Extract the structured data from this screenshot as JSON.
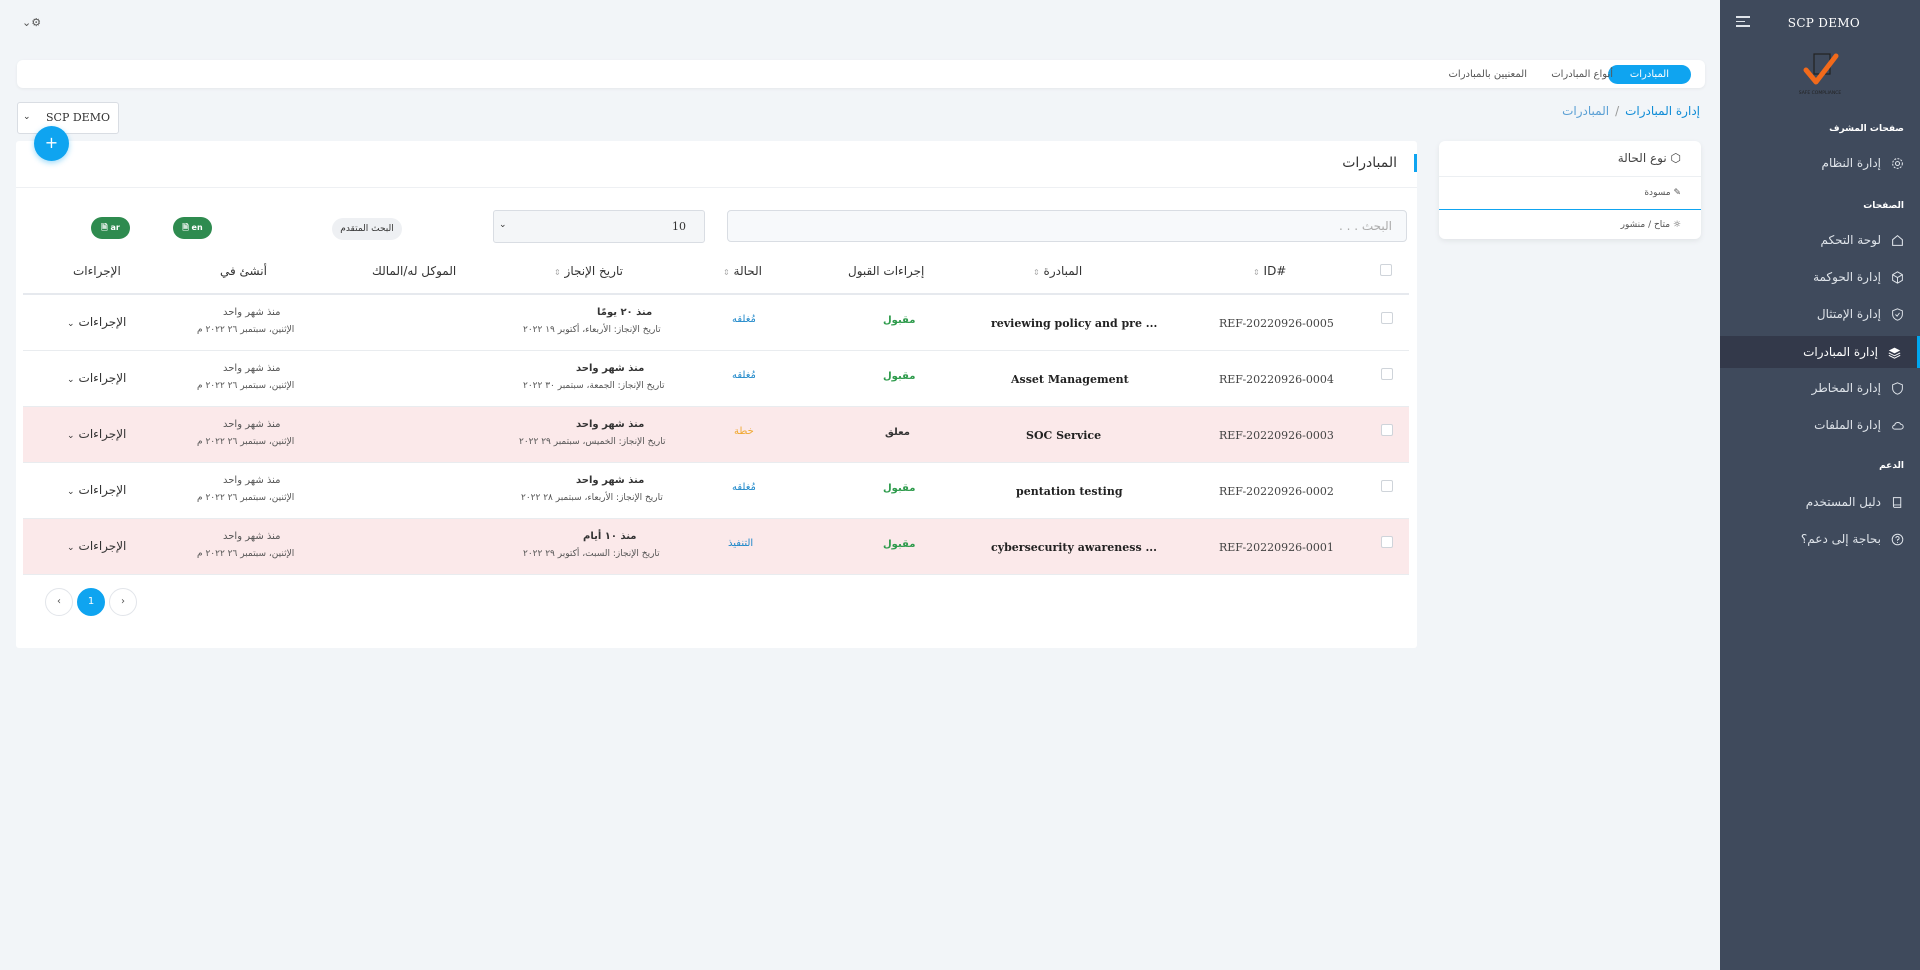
{
  "app": {
    "brand": "SCP DEMO",
    "logo_caption": "SAFE COMPLIANCE",
    "accent": "#0fa4f0",
    "sidebar_bg": "#3f4a5c"
  },
  "sidebar": {
    "section_admin": "صفحات المشرف",
    "section_pages": "الصفحات",
    "section_support": "الدعم",
    "items": [
      {
        "label": "إدارة النظام",
        "icon": "gear-icon"
      },
      {
        "label": "لوحة التحكم",
        "icon": "home-icon"
      },
      {
        "label": "إدارة الحوكمة",
        "icon": "cube-icon"
      },
      {
        "label": "إدارة الإمتثال",
        "icon": "shield-check-icon"
      },
      {
        "label": "إدارة المبادرات",
        "icon": "layers-icon",
        "active": true
      },
      {
        "label": "إدارة المخاطر",
        "icon": "shield-icon"
      },
      {
        "label": "إدارة الملفات",
        "icon": "cloud-icon"
      },
      {
        "label": "دليل المستخدم",
        "icon": "book-icon"
      },
      {
        "label": "بحاجة إلى دعم؟",
        "icon": "help-icon"
      }
    ]
  },
  "tabs": [
    {
      "label": "المبادرات",
      "active": true
    },
    {
      "label": "أنواع المبادرات"
    },
    {
      "label": "المعنيين بالمبادرات"
    }
  ],
  "breadcrumb": {
    "root": "إدارة المبادرات",
    "current": "المبادرات"
  },
  "company_select": "SCP DEMO",
  "card": {
    "title": "المبادرات",
    "search_placeholder": "البحث . . .",
    "page_size": "10",
    "advanced_search": "البحث المتقدم",
    "export_ar": "ar",
    "export_en": "en"
  },
  "table": {
    "headers": {
      "id": "ID#",
      "initiative": "المبادرة",
      "acceptance": "إجراءات القبول",
      "status": "الحالة",
      "due": "تاريخ الإنجاز",
      "owner": "الموكل له/المالك",
      "created": "أنشئ في",
      "actions": "الإجراءات"
    },
    "rows": [
      {
        "id": "REF-20220926-0005",
        "name": "reviewing policy and pre ...",
        "acceptance": "مقبول",
        "acceptance_color": "#2e9b4c",
        "status": "مُغلقه",
        "status_color": "#1b86c9",
        "due_rel": "منذ ٢٠ يومًا",
        "due_date": "تاريخ الإنجاز: الأربعاء، أكتوبر ١٩ ٢٠٢٢",
        "created_rel": "منذ شهر واحد",
        "created_date": "الإثنين، سبتمبر ٢٦ ٢٠٢٢ م",
        "actions": "الإجراءات",
        "highlight": false
      },
      {
        "id": "REF-20220926-0004",
        "name": "Asset Management",
        "acceptance": "مقبول",
        "acceptance_color": "#2e9b4c",
        "status": "مُغلقه",
        "status_color": "#1b86c9",
        "due_rel": "منذ شهر واحد",
        "due_date": "تاريخ الإنجاز: الجمعة، سبتمبر ٣٠ ٢٠٢٢",
        "created_rel": "منذ شهر واحد",
        "created_date": "الإثنين، سبتمبر ٢٦ ٢٠٢٢ م",
        "actions": "الإجراءات",
        "highlight": false
      },
      {
        "id": "REF-20220926-0003",
        "name": "SOC Service",
        "acceptance": "معلق",
        "acceptance_color": "#333333",
        "status": "خطة",
        "status_color": "#f0a830",
        "due_rel": "منذ شهر واحد",
        "due_date": "تاريخ الإنجاز: الخميس، سبتمبر ٢٩ ٢٠٢٢",
        "created_rel": "منذ شهر واحد",
        "created_date": "الإثنين، سبتمبر ٢٦ ٢٠٢٢ م",
        "actions": "الإجراءات",
        "highlight": true
      },
      {
        "id": "REF-20220926-0002",
        "name": "pentation testing",
        "acceptance": "مقبول",
        "acceptance_color": "#2e9b4c",
        "status": "مُغلقه",
        "status_color": "#1b86c9",
        "due_rel": "منذ شهر واحد",
        "due_date": "تاريخ الإنجاز: الأربعاء، سبتمبر ٢٨ ٢٠٢٢",
        "created_rel": "منذ شهر واحد",
        "created_date": "الإثنين، سبتمبر ٢٦ ٢٠٢٢ م",
        "actions": "الإجراءات",
        "highlight": false
      },
      {
        "id": "REF-20220926-0001",
        "name": "cybersecurity awareness ...",
        "acceptance": "مقبول",
        "acceptance_color": "#2e9b4c",
        "status": "التنفيذ",
        "status_color": "#1b86c9",
        "due_rel": "منذ ١٠ أيام",
        "due_date": "تاريخ الإنجاز: السبت، أكتوبر ٢٩ ٢٠٢٢",
        "created_rel": "منذ شهر واحد",
        "created_date": "الإثنين، سبتمبر ٢٦ ٢٠٢٢ م",
        "actions": "الإجراءات",
        "highlight": true
      }
    ]
  },
  "pagination": {
    "current": "1",
    "prev": "‹",
    "next": "›"
  },
  "filter": {
    "title": "نوع الحالة",
    "items": [
      {
        "label": "مسودة",
        "icon": "feather-icon"
      },
      {
        "label": "متاح / منشور",
        "icon": "sun-icon"
      }
    ]
  }
}
